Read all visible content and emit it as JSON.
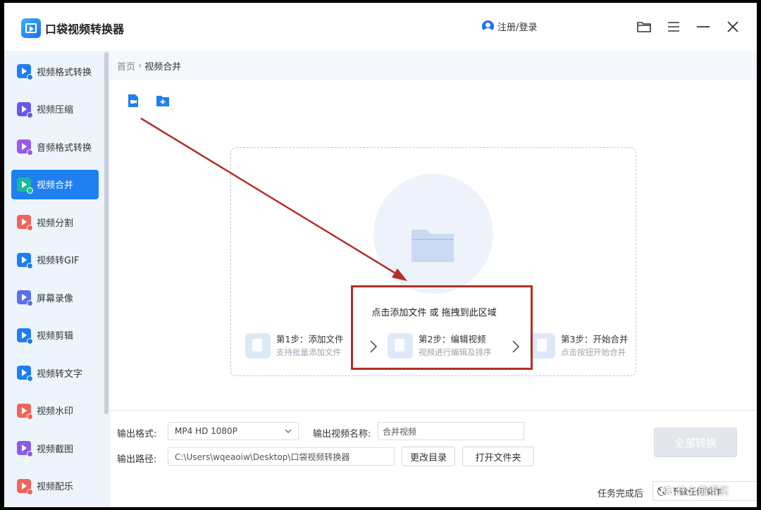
{
  "app": {
    "title": "口袋视频转换器",
    "login_label": "注册/登录"
  },
  "colors": {
    "accent": "#1e7ff0",
    "annotation": "#b3312a"
  },
  "sidebar": {
    "items": [
      {
        "label": "视频格式转换",
        "icon": "video-convert-icon",
        "color": "#1e7ff0",
        "badge": "#1e7ff0"
      },
      {
        "label": "视频压缩",
        "icon": "video-compress-icon",
        "color": "#6a57e8",
        "badge": "#6a57e8"
      },
      {
        "label": "音频格式转换",
        "icon": "audio-convert-icon",
        "color": "#9a5be6",
        "badge": "#9a5be6"
      },
      {
        "label": "视频合并",
        "icon": "video-merge-icon",
        "color": "#1fb6a0",
        "badge": "#26c27a",
        "active": true
      },
      {
        "label": "视频分割",
        "icon": "video-split-icon",
        "color": "#f0645a",
        "badge": "#f0645a"
      },
      {
        "label": "视频转GIF",
        "icon": "video-gif-icon",
        "color": "#1e7ff0",
        "badge": "#1e7ff0"
      },
      {
        "label": "屏幕录像",
        "icon": "screen-record-icon",
        "color": "#5a6ff0",
        "badge": "#5a6ff0"
      },
      {
        "label": "视频剪辑",
        "icon": "video-edit-icon",
        "color": "#1e7ff0",
        "badge": "#1e7ff0"
      },
      {
        "label": "视频转文字",
        "icon": "video-text-icon",
        "color": "#1e7ff0",
        "badge": "#1e7ff0"
      },
      {
        "label": "视频水印",
        "icon": "video-watermark-icon",
        "color": "#f0645a",
        "badge": "#f0645a"
      },
      {
        "label": "视频截图",
        "icon": "video-screenshot-icon",
        "color": "#8a5ce8",
        "badge": "#8a5ce8"
      },
      {
        "label": "视频配乐",
        "icon": "video-music-icon",
        "color": "#f0645a",
        "badge": "#f0645a"
      }
    ]
  },
  "breadcrumb": {
    "home": "首页",
    "separator": "›",
    "current": "视频合并"
  },
  "dropzone": {
    "hint": "点击添加文件 或 拖拽到此区域",
    "steps": [
      {
        "title": "第1步：添加文件",
        "sub": "支持批量添加文件"
      },
      {
        "title": "第2步：编辑视频",
        "sub": "视频进行编辑及排序"
      },
      {
        "title": "第3步：开始合并",
        "sub": "点击按钮开始合并"
      }
    ]
  },
  "output": {
    "format_label": "输出格式:",
    "format_value": "MP4   HD 1080P",
    "name_label": "输出视频名称:",
    "name_value": "合并视频",
    "path_label": "输出路径:",
    "path_value": "C:\\Users\\wqeaoiw\\Desktop\\口袋视频转换器",
    "change_dir": "更改目录",
    "open_folder": "打开文件夹",
    "convert_all": "全部转换",
    "after_label": "任务完成后",
    "after_value": "不做任何操作"
  },
  "watermark": {
    "text": "什么值得买",
    "icon": "值"
  }
}
